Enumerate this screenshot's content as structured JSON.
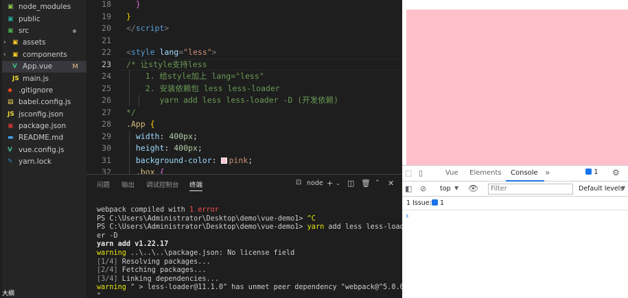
{
  "explorer": {
    "items": [
      {
        "label": "node_modules",
        "icon": "node-modules-folder-icon",
        "icon_color": "#8bc34a"
      },
      {
        "label": "public",
        "icon": "public-folder-icon",
        "icon_color": "#26a69a"
      },
      {
        "label": "src",
        "icon": "src-folder-icon",
        "icon_color": "#4caf50"
      },
      {
        "label": "assets",
        "icon": "assets-folder-icon",
        "icon_color": "#ffca28"
      },
      {
        "label": "components",
        "icon": "components-folder-icon",
        "icon_color": "#ffca28"
      },
      {
        "label": "App.vue",
        "icon": "vue-file-icon",
        "icon_color": "#41b883",
        "badge": "M"
      },
      {
        "label": "main.js",
        "icon": "js-file-icon",
        "icon_color": "#f1dd35"
      },
      {
        "label": ".gitignore",
        "icon": "git-file-icon",
        "icon_color": "#e64a19"
      },
      {
        "label": "babel.config.js",
        "icon": "babel-file-icon",
        "icon_color": "#f5da55"
      },
      {
        "label": "jsconfig.json",
        "icon": "js-file-icon",
        "icon_color": "#f1dd35"
      },
      {
        "label": "package.json",
        "icon": "npm-file-icon",
        "icon_color": "#cb3837"
      },
      {
        "label": "README.md",
        "icon": "markdown-file-icon",
        "icon_color": "#42a5f5"
      },
      {
        "label": "vue.config.js",
        "icon": "vue-file-icon",
        "icon_color": "#41b883"
      },
      {
        "label": "yarn.lock",
        "icon": "yarn-file-icon",
        "icon_color": "#2c8ebb"
      }
    ],
    "bottom_label": "大纲"
  },
  "editor": {
    "line_numbers": [
      "18",
      "19",
      "20",
      "21",
      "22",
      "23",
      "24",
      "25",
      "26",
      "27",
      "28",
      "29",
      "30",
      "31",
      "32"
    ],
    "current_line": "23",
    "lines": {
      "l18": "}",
      "l19": "}",
      "l20_a": "</",
      "l20_b": "script",
      "l20_c": ">",
      "l22_a": "<",
      "l22_b": "style",
      "l22_c": " lang",
      "l22_d": "=",
      "l22_e": "\"less\"",
      "l22_f": ">",
      "l23": "/* 让style支持less",
      "l24": "    1. 给style加上 lang=\"less\"",
      "l25": "    2. 安装依赖包 less less-loader",
      "l26": "       yarn add less less-loader -D (开发依赖)",
      "l27": "*/",
      "l28_a": ".App",
      "l28_b": " {",
      "l29_a": "  width",
      "l29_b": ": ",
      "l29_c": "400px",
      "l29_d": ";",
      "l30_a": "  height",
      "l30_b": ": ",
      "l30_c": "400px",
      "l30_d": ";",
      "l31_a": "  background-color",
      "l31_b": ": ",
      "l31_c": "pink",
      "l31_d": ";",
      "l32_a": "  .box",
      "l32_b": " {"
    }
  },
  "panel": {
    "tabs": [
      "问题",
      "输出",
      "调试控制台",
      "终端"
    ],
    "active_tab": "终端",
    "terminal_name": "node",
    "terminal": {
      "t1_a": "webpack compiled with ",
      "t1_b": "1 error",
      "t2_a": "PS C:\\Users\\Administrator\\Desktop\\demo\\vue-demo1> ",
      "t2_b": "^C",
      "t3_a": "PS C:\\Users\\Administrator\\Desktop\\demo\\vue-demo1> ",
      "t3_b": "yarn",
      "t3_c": " add less less-load",
      "t4": "er -D",
      "t5": "yarn add v1.22.17",
      "t6_a": "warning",
      "t6_b": " ..\\..\\..\\package.json: No license field",
      "t7_a": "[1/4]",
      "t7_b": " Resolving packages...",
      "t8_a": "[2/4]",
      "t8_b": " Fetching packages...",
      "t9_a": "[3/4]",
      "t9_b": " Linking dependencies...",
      "t10_a": "warning",
      "t10_b": " \" > less-loader@11.1.0\" has unmet peer dependency \"webpack@^5.0.0",
      "t11": "\""
    }
  },
  "devtools": {
    "tabs": [
      "Vue",
      "Elements",
      "Console"
    ],
    "active_tab": "Console",
    "issues_count": "1",
    "context": "top",
    "filter_placeholder": "Filter",
    "levels": "Default levels",
    "issues_label": "1 Issue:",
    "issues_badge": "1",
    "prompt": "›"
  },
  "preview": {
    "box_color": "#ffc0cb"
  }
}
